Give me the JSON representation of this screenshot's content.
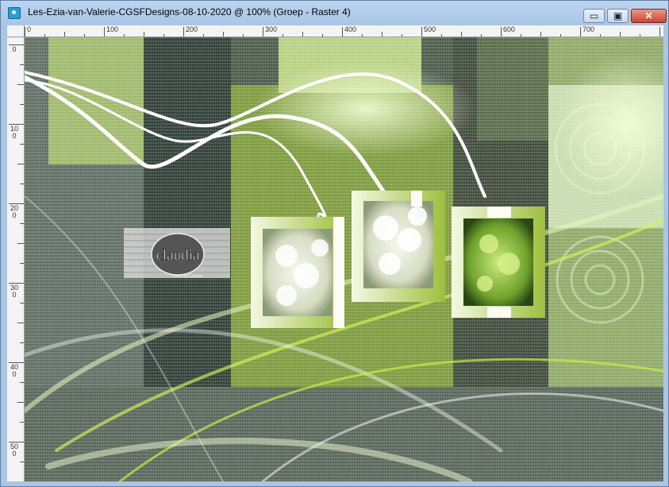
{
  "window": {
    "title": "Les-Ezia-van-Valerie-CGSFDesigns-08-10-2020 @ 100% (Groep - Raster 4)",
    "controls": {
      "minimize": "▭",
      "maximize": "▣",
      "close": "✕"
    }
  },
  "ruler": {
    "horizontal": [
      "0",
      "100",
      "200",
      "300",
      "400",
      "500",
      "600",
      "700"
    ],
    "vertical": [
      "0",
      "100",
      "200",
      "300",
      "400",
      "500"
    ]
  },
  "canvas": {
    "watermark": {
      "name": "claudia",
      "tagline": "Tubed by Claudia"
    },
    "icons": [
      "app-icon",
      "minimize-icon",
      "maximize-icon",
      "close-icon"
    ],
    "colors": {
      "lime": "#a7c23c",
      "dark_green": "#35463a",
      "light_green": "#d8eeaa",
      "white": "#ffffff"
    }
  }
}
